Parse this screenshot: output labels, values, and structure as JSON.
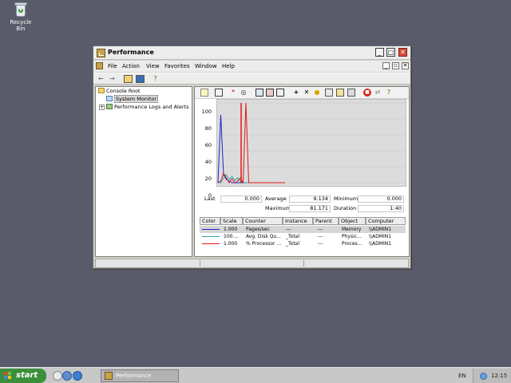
{
  "desktop": {
    "recycle_bin_label": "Recycle Bin"
  },
  "window": {
    "title": "Performance",
    "controls": {
      "minimize": "_",
      "maximize": "□",
      "close": "✕"
    }
  },
  "menubar": {
    "items": [
      "File",
      "Action",
      "View",
      "Favorites",
      "Window",
      "Help"
    ],
    "mdi_controls": {
      "minimize": "_",
      "restore": "▫",
      "close": "✕"
    }
  },
  "tree": {
    "root": "Console Root",
    "items": [
      {
        "label": "System Monitor",
        "selected": true
      },
      {
        "label": "Performance Logs and Alerts",
        "selected": false
      }
    ],
    "expander_symbol": "+"
  },
  "graph": {
    "y_ticks": [
      "100",
      "80",
      "60",
      "40",
      "20",
      "0"
    ]
  },
  "chart_data": {
    "type": "line",
    "ylim": [
      0,
      100
    ],
    "y_ticks": [
      100,
      80,
      60,
      40,
      20,
      0
    ],
    "series": [
      {
        "name": "Pages/sec",
        "color": "#2222cc",
        "values": [
          0,
          85,
          10,
          4,
          2,
          0,
          0,
          0,
          0,
          0,
          0,
          0,
          0,
          0,
          0,
          0,
          0,
          0,
          0,
          0,
          0,
          0,
          0,
          0,
          0
        ]
      },
      {
        "name": "Avg. Disk Qu...",
        "color": "#28a8a8",
        "values": [
          0,
          0,
          6,
          10,
          4,
          8,
          3,
          6,
          2,
          0,
          0,
          0,
          0,
          0,
          0,
          0,
          0,
          0,
          0,
          0,
          0,
          0,
          0,
          0,
          0
        ]
      },
      {
        "name": "% Processor ...",
        "color": "#e01818",
        "values": [
          0,
          2,
          12,
          6,
          0,
          5,
          0,
          2,
          6,
          0,
          100,
          0,
          0,
          0,
          0,
          0,
          0,
          0,
          0,
          0,
          0,
          0,
          0,
          0,
          0
        ]
      }
    ]
  },
  "stats": {
    "last_label": "Last",
    "last": "0.000",
    "average_label": "Average",
    "average": "9.134",
    "minimum_label": "Minimum",
    "minimum": "0.000",
    "maximum_label": "Maximum",
    "maximum": "81.171",
    "duration_label": "Duration",
    "duration": "1:40"
  },
  "table": {
    "headers": [
      "Color",
      "Scale",
      "Counter",
      "Instance",
      "Parent",
      "Object",
      "Computer"
    ],
    "rows": [
      {
        "color": "#2222cc",
        "scale": "1.000",
        "counter": "Pages/sec",
        "instance": "---",
        "parent": "---",
        "object": "Memory",
        "computer": "\\\\ADMIN1"
      },
      {
        "color": "#28a8a8",
        "scale": "100....",
        "counter": "Avg. Disk Qu...",
        "instance": "_Total",
        "parent": "---",
        "object": "Physic...",
        "computer": "\\\\ADMIN1"
      },
      {
        "color": "#e01818",
        "scale": "1.000",
        "counter": "% Processor ...",
        "instance": "_Total",
        "parent": "---",
        "object": "Proces...",
        "computer": "\\\\ADMIN1"
      }
    ]
  },
  "taskbar": {
    "start_label": "start",
    "task_label": "Performance",
    "language": "EN",
    "clock": "12:15"
  }
}
